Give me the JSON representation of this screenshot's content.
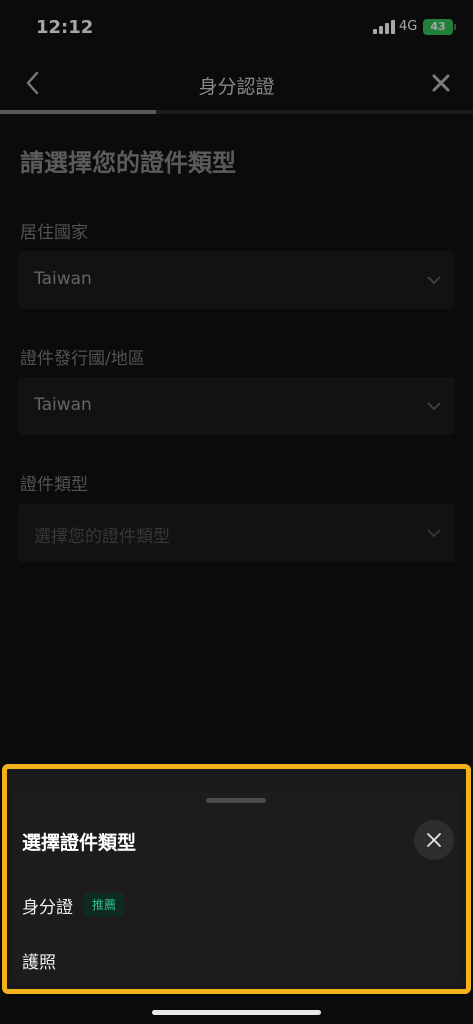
{
  "status_bar": {
    "time": "12:12",
    "network": "4G",
    "battery": "43"
  },
  "nav": {
    "title": "身分認證",
    "back_icon": "chevron-left-icon",
    "close_icon": "close-icon",
    "progress": 0.33
  },
  "form": {
    "heading": "請選擇您的證件類型",
    "fields": [
      {
        "label": "居住國家",
        "value": "Taiwan"
      },
      {
        "label": "證件發行國/地區",
        "value": "Taiwan"
      },
      {
        "label": "證件類型",
        "placeholder": "選擇您的證件類型"
      }
    ]
  },
  "sheet": {
    "title": "選擇證件類型",
    "options": [
      {
        "label": "身分證",
        "badge": "推薦"
      },
      {
        "label": "護照"
      }
    ]
  },
  "colors": {
    "highlight": "#f2b21b",
    "badge_text": "#2fbf8a",
    "battery": "#34c759"
  }
}
